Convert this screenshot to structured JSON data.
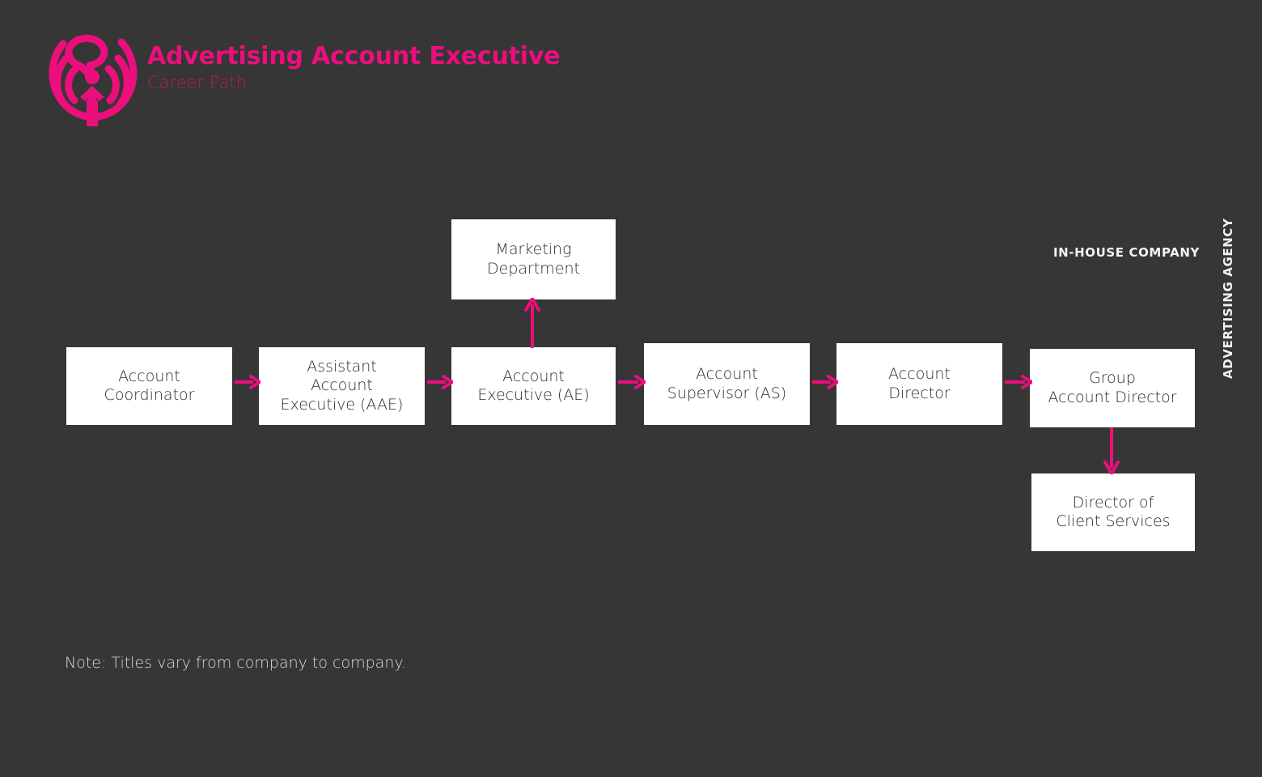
{
  "page": {
    "background_color": "#363636",
    "accent_color": "#EC0E7C",
    "subtitle_color": "#C0175E",
    "box_fill": "#FFFFFF",
    "box_text_color": "#2B2B2B",
    "label_color": "#F2F2F2"
  },
  "header": {
    "logo_icon": "broadcast-person-speech-bubble-icon",
    "title": "Advertising Account Executive",
    "subtitle": "Career Path"
  },
  "chart_data": {
    "type": "diagram",
    "title": "Advertising Account Executive Career Path",
    "nodes": [
      {
        "id": "account-coordinator",
        "label": "Account\nCoordinator"
      },
      {
        "id": "assistant-account-executive",
        "label": "Assistant\nAccount\nExecutive (AAE)"
      },
      {
        "id": "account-executive",
        "label": "Account\nExecutive (AE)"
      },
      {
        "id": "account-supervisor",
        "label": "Account\nSupervisor (AS)"
      },
      {
        "id": "account-director",
        "label": "Account\nDirector"
      },
      {
        "id": "group-account-director",
        "label": "Group\nAccount Director"
      },
      {
        "id": "marketing-department",
        "label": "Marketing\nDepartment"
      },
      {
        "id": "director-of-client-services",
        "label": "Director of\nClient Services"
      }
    ],
    "edges": [
      {
        "from": "account-coordinator",
        "to": "assistant-account-executive",
        "direction": "right"
      },
      {
        "from": "assistant-account-executive",
        "to": "account-executive",
        "direction": "right"
      },
      {
        "from": "account-executive",
        "to": "account-supervisor",
        "direction": "right"
      },
      {
        "from": "account-supervisor",
        "to": "account-director",
        "direction": "right"
      },
      {
        "from": "account-director",
        "to": "group-account-director",
        "direction": "right"
      },
      {
        "from": "account-executive",
        "to": "marketing-department",
        "direction": "up"
      },
      {
        "from": "group-account-director",
        "to": "director-of-client-services",
        "direction": "down"
      }
    ]
  },
  "side_labels": {
    "in_house": "IN-HOUSE COMPANY",
    "advertising_agency": "ADVERTISING AGENCY"
  },
  "footnote": {
    "text": "Note: Titles vary from company to company."
  }
}
